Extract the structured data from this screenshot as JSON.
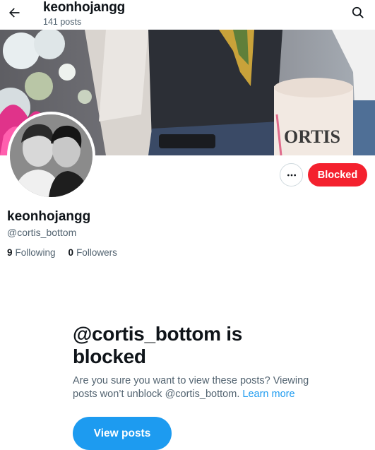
{
  "header": {
    "title": "keonhojangg",
    "post_count": "141 posts",
    "back_icon": "arrow-left-icon",
    "search_icon": "search-icon"
  },
  "banner": {
    "cake_text": "ORTIS"
  },
  "profile": {
    "display_name": "keonhojangg",
    "handle": "@cortis_bottom",
    "following_count": "9",
    "following_label": "Following",
    "followers_count": "0",
    "followers_label": "Followers",
    "more_icon": "more-horizontal-icon",
    "blocked_label": "Blocked"
  },
  "blocked_notice": {
    "title": "@cortis_bottom is blocked",
    "description": "Are you sure you want to view these posts? Viewing posts won’t unblock @cortis_bottom.",
    "learn_more": "Learn more",
    "view_posts_label": "View posts"
  },
  "colors": {
    "accent": "#1d9bf0",
    "danger": "#f4212e",
    "text_primary": "#0f1419",
    "text_secondary": "#536471"
  }
}
